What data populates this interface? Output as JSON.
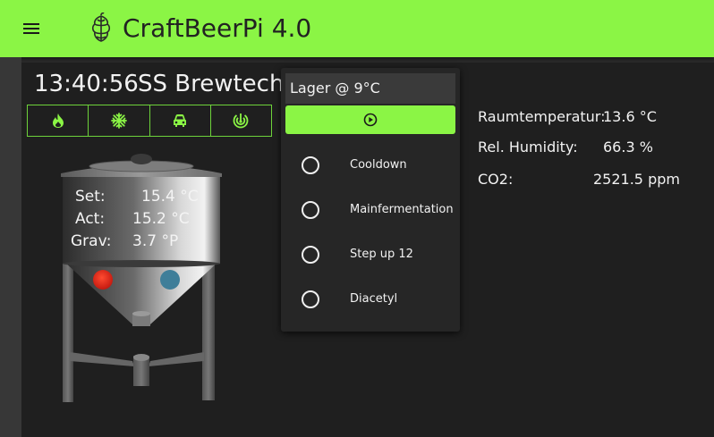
{
  "header": {
    "title": "CraftBeerPi 4.0",
    "menu_icon": "menu-icon",
    "logo_icon": "hop-icon"
  },
  "dashboard": {
    "clock": "13:40:56",
    "brewery_name": "SS Brewtech"
  },
  "actors": [
    {
      "icon": "flame-icon"
    },
    {
      "icon": "snowflake-icon"
    },
    {
      "icon": "car-icon"
    },
    {
      "icon": "radar-icon"
    }
  ],
  "fermenter": {
    "set_label": "Set:",
    "set_value": "15.4 °C",
    "act_label": "Act:",
    "act_value": "15.2 °C",
    "grav_label": "Grav:",
    "grav_value": "3.7 °P",
    "heater_color": "#e0281a",
    "cooler_color": "#3f7e99"
  },
  "recipe_panel": {
    "title": "Lager @ 9°C",
    "start_icon": "play-icon",
    "steps": [
      {
        "label": "Cooldown"
      },
      {
        "label": "Mainfermentation"
      },
      {
        "label": "Step up 12"
      },
      {
        "label": "Diacetyl"
      }
    ]
  },
  "sensors": [
    {
      "label": "Raumtemperatur:",
      "value": "13.6 °C"
    },
    {
      "label": "Rel. Humidity:",
      "value": "66.3 %"
    },
    {
      "label": "CO2:",
      "value": "2521.5 ppm"
    }
  ],
  "colors": {
    "accent": "#8bf545",
    "background": "#1f1f1f",
    "panel": "#262626"
  }
}
